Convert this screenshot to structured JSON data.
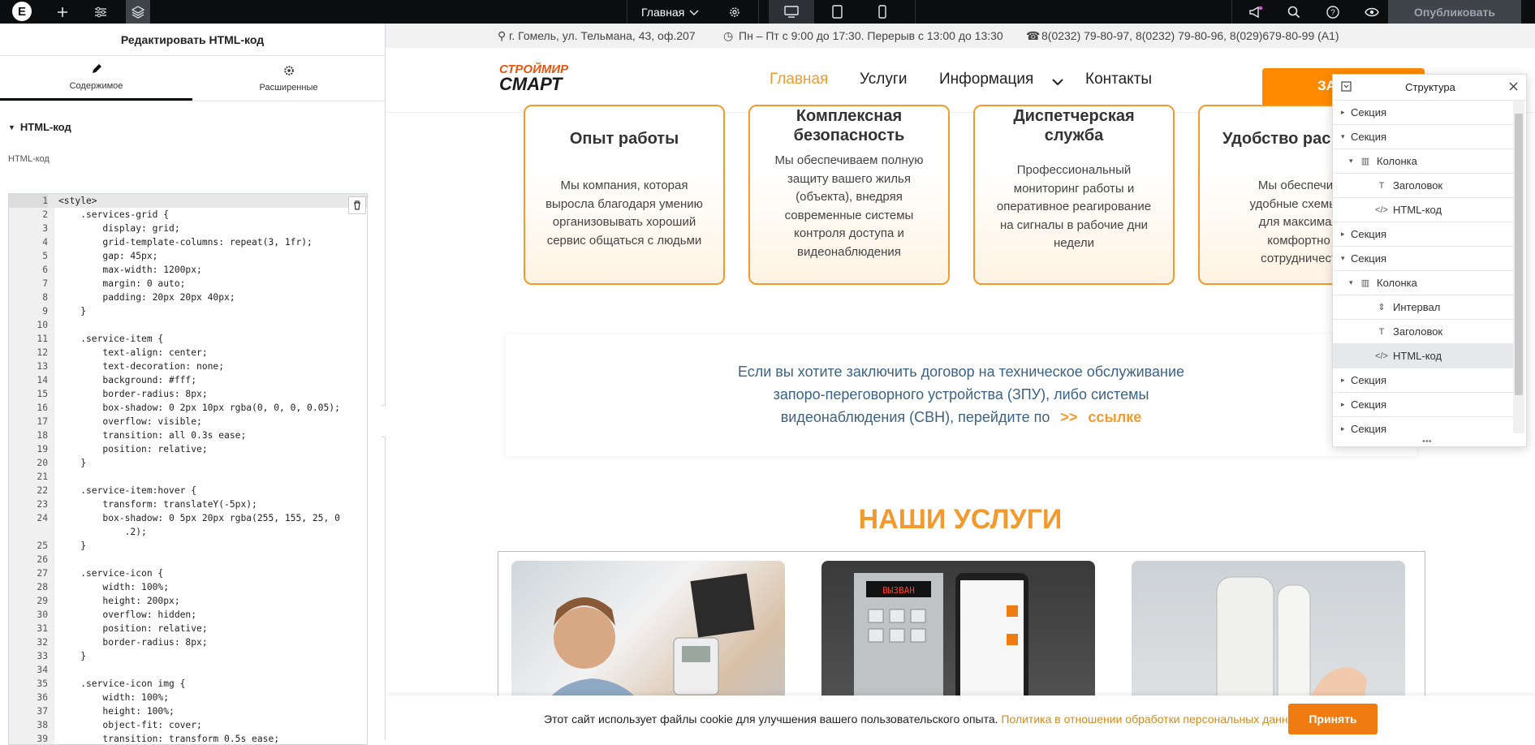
{
  "topbar": {
    "logo": "E",
    "add_icon": "+",
    "page_name": "Главная",
    "publish_label": "Опубликовать",
    "icons": [
      "elementor-logo",
      "plus-icon",
      "sliders-icon",
      "layers-icon",
      "chevron-down-icon",
      "gear-icon",
      "desktop-icon",
      "tablet-icon",
      "mobile-icon",
      "megaphone-icon",
      "search-icon",
      "help-icon",
      "eye-icon"
    ]
  },
  "panel": {
    "title": "Редактировать HTML-код",
    "tab_content": "Содержимое",
    "tab_advanced": "Расширенные",
    "section_title": "HTML-код",
    "field_label": "HTML-код",
    "code_lines": [
      [
        "1",
        "<style>"
      ],
      [
        "2",
        "    .services-grid {"
      ],
      [
        "3",
        "        display: grid;"
      ],
      [
        "4",
        "        grid-template-columns: repeat(3, 1fr);"
      ],
      [
        "5",
        "        gap: 45px;"
      ],
      [
        "6",
        "        max-width: 1200px;"
      ],
      [
        "7",
        "        margin: 0 auto;"
      ],
      [
        "8",
        "        padding: 20px 20px 40px;"
      ],
      [
        "9",
        "    }"
      ],
      [
        "10",
        ""
      ],
      [
        "11",
        "    .service-item {"
      ],
      [
        "12",
        "        text-align: center;"
      ],
      [
        "13",
        "        text-decoration: none;"
      ],
      [
        "14",
        "        background: #fff;"
      ],
      [
        "15",
        "        border-radius: 8px;"
      ],
      [
        "16",
        "        box-shadow: 0 2px 10px rgba(0, 0, 0, 0.05);"
      ],
      [
        "17",
        "        overflow: visible;"
      ],
      [
        "18",
        "        transition: all 0.3s ease;"
      ],
      [
        "19",
        "        position: relative;"
      ],
      [
        "20",
        "    }"
      ],
      [
        "21",
        ""
      ],
      [
        "22",
        "    .service-item:hover {"
      ],
      [
        "23",
        "        transform: translateY(-5px);"
      ],
      [
        "24",
        "        box-shadow: 0 5px 20px rgba(255, 155, 25, 0"
      ],
      [
        "",
        "            .2);"
      ],
      [
        "25",
        "    }"
      ],
      [
        "26",
        ""
      ],
      [
        "27",
        "    .service-icon {"
      ],
      [
        "28",
        "        width: 100%;"
      ],
      [
        "29",
        "        height: 200px;"
      ],
      [
        "30",
        "        overflow: hidden;"
      ],
      [
        "31",
        "        position: relative;"
      ],
      [
        "32",
        "        border-radius: 8px;"
      ],
      [
        "33",
        "    }"
      ],
      [
        "34",
        ""
      ],
      [
        "35",
        "    .service-icon img {"
      ],
      [
        "36",
        "        width: 100%;"
      ],
      [
        "37",
        "        height: 100%;"
      ],
      [
        "38",
        "        object-fit: cover;"
      ],
      [
        "39",
        "        transition: transform 0.5s ease;"
      ]
    ]
  },
  "site": {
    "address": "г. Гомель, ул. Тельмана, 43, оф.207",
    "hours": "Пн – Пт с 9:00 до 17:30. Перерыв с 13:00 до 13:30",
    "phones": "8(0232) 79-80-97, 8(0232) 79-80-96, 8(029)679-80-99 (A1)",
    "brand_top": "СТРОЙМИР",
    "brand_bottom": "СМАРТ",
    "nav": [
      "Главная",
      "Услуги",
      "Информация",
      "Контакты"
    ],
    "cta": "ЗА",
    "cards": [
      {
        "title": "Опыт работы",
        "text": "Мы компания, которая выросла благодаря умению организовывать хороший сервис общаться с людьми"
      },
      {
        "title": "Комплексная безопасность",
        "text": "Мы обеспечиваем полную защиту вашего жилья (объекта), внедряя современные системы контроля доступа и видеонаблюдения"
      },
      {
        "title": "Диспетчерская служба",
        "text": "Профессиональный мониторинг работы и оперативное реагирование на сигналы в рабочие дни недели"
      },
      {
        "title": "Удобство рас",
        "text": "Мы обеспечив удобные схемы о для максимал комфортно сотрудничест"
      }
    ],
    "promo_line1": "Если вы хотите заключить договор на техническое обслуживание",
    "promo_line2": "запоро-переговорного устройства (ЗПУ), либо системы",
    "promo_line3": "видеонаблюдения (СВН), перейдите по",
    "promo_arrows": ">>",
    "promo_link": "ссылке",
    "services_title": "НАШИ УСЛУГИ",
    "cookie_text": "Этот сайт использует файлы cookie для улучшения вашего пользовательского опыта.",
    "cookie_link": "Политика в отношении обработки персональных данных",
    "cookie_accept": "Принять"
  },
  "navigator": {
    "title": "Структура",
    "rows": [
      {
        "label": "Секция",
        "depth": 0,
        "arrow": "▸",
        "icon": ""
      },
      {
        "label": "Секция",
        "depth": 0,
        "arrow": "▾",
        "icon": ""
      },
      {
        "label": "Колонка",
        "depth": 1,
        "arrow": "▾",
        "icon": "▥"
      },
      {
        "label": "Заголовок",
        "depth": 2,
        "arrow": "",
        "icon": "T"
      },
      {
        "label": "HTML-код",
        "depth": 2,
        "arrow": "",
        "icon": "</>"
      },
      {
        "label": "Секция",
        "depth": 0,
        "arrow": "▸",
        "icon": ""
      },
      {
        "label": "Секция",
        "depth": 0,
        "arrow": "▾",
        "icon": ""
      },
      {
        "label": "Колонка",
        "depth": 1,
        "arrow": "▾",
        "icon": "▥"
      },
      {
        "label": "Интервал",
        "depth": 2,
        "arrow": "",
        "icon": "⇕"
      },
      {
        "label": "Заголовок",
        "depth": 2,
        "arrow": "",
        "icon": "T"
      },
      {
        "label": "HTML-код",
        "depth": 2,
        "arrow": "",
        "icon": "</>",
        "selected": true
      },
      {
        "label": "Секция",
        "depth": 0,
        "arrow": "▸",
        "icon": ""
      },
      {
        "label": "Секция",
        "depth": 0,
        "arrow": "▸",
        "icon": ""
      },
      {
        "label": "Секция",
        "depth": 0,
        "arrow": "▸",
        "icon": ""
      }
    ]
  },
  "colors": {
    "accent": "#f39a2e",
    "cta": "#ff8a00",
    "topbar": "#0c0d0e",
    "promo_text": "#3c6384"
  }
}
